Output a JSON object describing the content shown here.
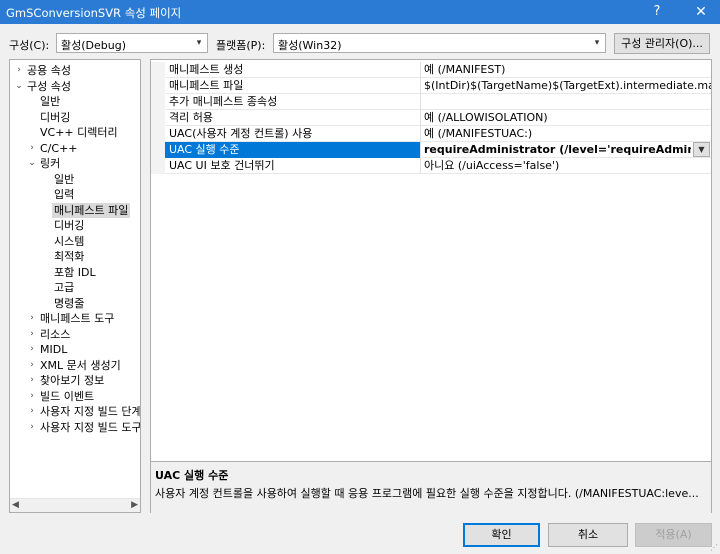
{
  "window": {
    "title": "GmSConversionSVR 속성 페이지",
    "help": "?",
    "close": "✕"
  },
  "toolbar": {
    "config_label": "구성(C):",
    "config_value": "활성(Debug)",
    "platform_label": "플랫폼(P):",
    "platform_value": "활성(Win32)",
    "config_manager": "구성 관리자(O)..."
  },
  "tree": {
    "items": [
      {
        "exp": "›",
        "label": "공용 속성"
      },
      {
        "exp": "⌄",
        "label": "구성 속성"
      },
      {
        "exp": "",
        "label": "일반"
      },
      {
        "exp": "",
        "label": "디버깅"
      },
      {
        "exp": "",
        "label": "VC++ 디렉터리"
      },
      {
        "exp": "›",
        "label": "C/C++"
      },
      {
        "exp": "⌄",
        "label": "링커"
      },
      {
        "exp": "",
        "label": "일반"
      },
      {
        "exp": "",
        "label": "입력"
      },
      {
        "exp": "",
        "label": "매니페스트 파일"
      },
      {
        "exp": "",
        "label": "디버깅"
      },
      {
        "exp": "",
        "label": "시스템"
      },
      {
        "exp": "",
        "label": "최적화"
      },
      {
        "exp": "",
        "label": "포함 IDL"
      },
      {
        "exp": "",
        "label": "고급"
      },
      {
        "exp": "",
        "label": "명령줄"
      },
      {
        "exp": "›",
        "label": "매니페스트 도구"
      },
      {
        "exp": "›",
        "label": "리소스"
      },
      {
        "exp": "›",
        "label": "MIDL"
      },
      {
        "exp": "›",
        "label": "XML 문서 생성기"
      },
      {
        "exp": "›",
        "label": "찾아보기 정보"
      },
      {
        "exp": "›",
        "label": "빌드 이벤트"
      },
      {
        "exp": "›",
        "label": "사용자 지정 빌드 단계"
      },
      {
        "exp": "›",
        "label": "사용자 지정 빌드 도구"
      }
    ],
    "selected_label": "매니페스트 파일"
  },
  "properties": {
    "rows": [
      {
        "name": "매니페스트 생성",
        "value": "예 (/MANIFEST)"
      },
      {
        "name": "매니페스트 파일",
        "value": "$(IntDir)$(TargetName)$(TargetExt).intermediate.manifest"
      },
      {
        "name": "추가 매니페스트 종속성",
        "value": ""
      },
      {
        "name": "격리 허용",
        "value": "예 (/ALLOWISOLATION)"
      },
      {
        "name": "UAC(사용자 계정 컨트롤) 사용",
        "value": "예 (/MANIFESTUAC:)"
      },
      {
        "name": "UAC 실행 수준",
        "value": "requireAdministrator (/level='requireAdministrator')"
      },
      {
        "name": "UAC UI 보호 건너뛰기",
        "value": "아니요 (/uiAccess='false')"
      }
    ],
    "selected_name": "UAC 실행 수준"
  },
  "description": {
    "title": "UAC 실행 수준",
    "text": "사용자 계정 컨트롤을 사용하여 실행할 때 응용 프로그램에 필요한 실행 수준을 지정합니다.  (/MANIFESTUAC:leve..."
  },
  "buttons": {
    "ok": "확인",
    "cancel": "취소",
    "apply": "적용(A)"
  }
}
